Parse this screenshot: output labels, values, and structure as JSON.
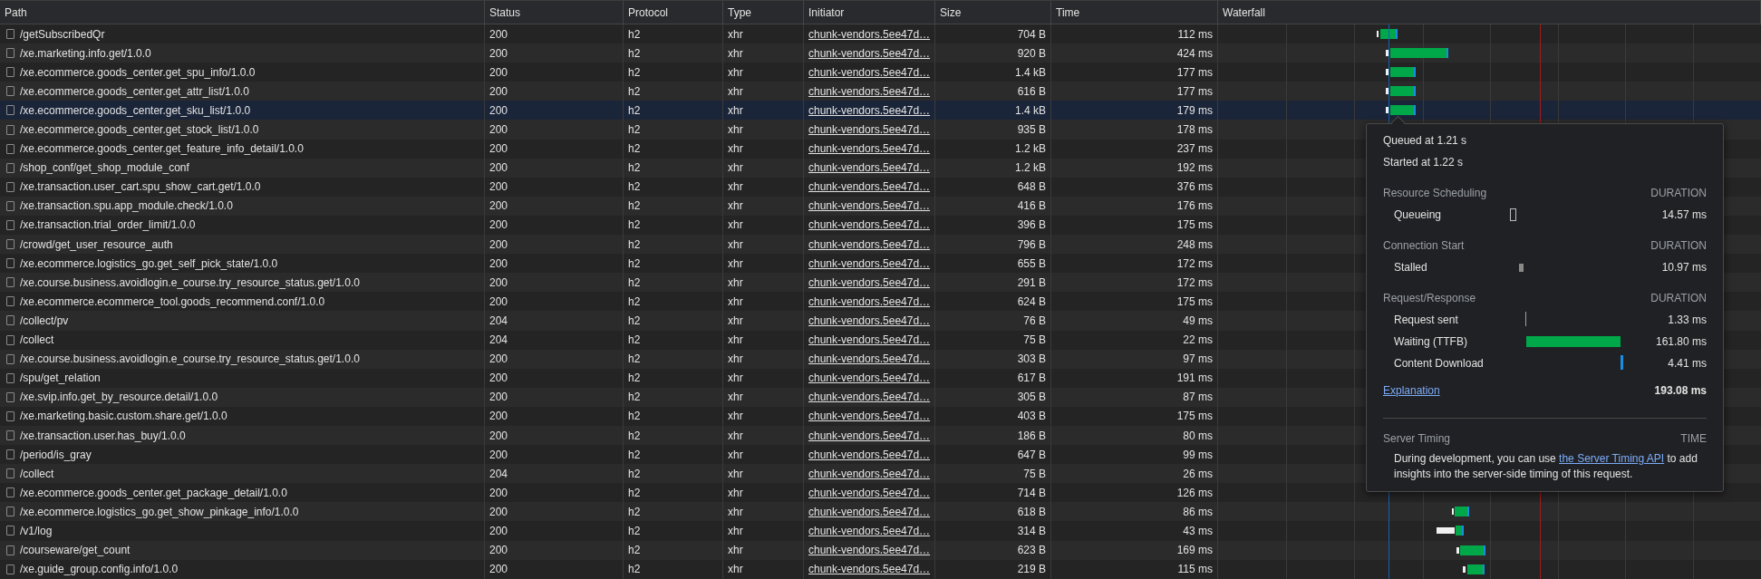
{
  "table": {
    "columns": [
      "Path",
      "Status",
      "Protocol",
      "Type",
      "Initiator",
      "Size",
      "Time",
      "Waterfall"
    ],
    "rows": [
      {
        "path": "/getSubscribedQr",
        "status": "200",
        "protocol": "h2",
        "type": "xhr",
        "initiator": "chunk-vendors.5ee47d…",
        "size": "704 B",
        "time": "112 ms",
        "checked": false,
        "selected": false
      },
      {
        "path": "/xe.marketing.info.get/1.0.0",
        "status": "200",
        "protocol": "h2",
        "type": "xhr",
        "initiator": "chunk-vendors.5ee47d…",
        "size": "920 B",
        "time": "424 ms",
        "checked": false,
        "selected": false
      },
      {
        "path": "/xe.ecommerce.goods_center.get_spu_info/1.0.0",
        "status": "200",
        "protocol": "h2",
        "type": "xhr",
        "initiator": "chunk-vendors.5ee47d…",
        "size": "1.4 kB",
        "time": "177 ms",
        "checked": false,
        "selected": false
      },
      {
        "path": "/xe.ecommerce.goods_center.get_attr_list/1.0.0",
        "status": "200",
        "protocol": "h2",
        "type": "xhr",
        "initiator": "chunk-vendors.5ee47d…",
        "size": "616 B",
        "time": "177 ms",
        "checked": false,
        "selected": false
      },
      {
        "path": "/xe.ecommerce.goods_center.get_sku_list/1.0.0",
        "status": "200",
        "protocol": "h2",
        "type": "xhr",
        "initiator": "chunk-vendors.5ee47d…",
        "size": "1.4 kB",
        "time": "179 ms",
        "checked": false,
        "selected": true
      },
      {
        "path": "/xe.ecommerce.goods_center.get_stock_list/1.0.0",
        "status": "200",
        "protocol": "h2",
        "type": "xhr",
        "initiator": "chunk-vendors.5ee47d…",
        "size": "935 B",
        "time": "178 ms",
        "checked": false,
        "selected": false
      },
      {
        "path": "/xe.ecommerce.goods_center.get_feature_info_detail/1.0.0",
        "status": "200",
        "protocol": "h2",
        "type": "xhr",
        "initiator": "chunk-vendors.5ee47d…",
        "size": "1.2 kB",
        "time": "237 ms",
        "checked": false,
        "selected": false
      },
      {
        "path": "/shop_conf/get_shop_module_conf",
        "status": "200",
        "protocol": "h2",
        "type": "xhr",
        "initiator": "chunk-vendors.5ee47d…",
        "size": "1.2 kB",
        "time": "192 ms",
        "checked": false,
        "selected": false
      },
      {
        "path": "/xe.transaction.user_cart.spu_show_cart.get/1.0.0",
        "status": "200",
        "protocol": "h2",
        "type": "xhr",
        "initiator": "chunk-vendors.5ee47d…",
        "size": "648 B",
        "time": "376 ms",
        "checked": false,
        "selected": false
      },
      {
        "path": "/xe.transaction.spu.app_module.check/1.0.0",
        "status": "200",
        "protocol": "h2",
        "type": "xhr",
        "initiator": "chunk-vendors.5ee47d…",
        "size": "416 B",
        "time": "176 ms",
        "checked": false,
        "selected": false
      },
      {
        "path": "/xe.transaction.trial_order_limit/1.0.0",
        "status": "200",
        "protocol": "h2",
        "type": "xhr",
        "initiator": "chunk-vendors.5ee47d…",
        "size": "396 B",
        "time": "175 ms",
        "checked": false,
        "selected": false
      },
      {
        "path": "/crowd/get_user_resource_auth",
        "status": "200",
        "protocol": "h2",
        "type": "xhr",
        "initiator": "chunk-vendors.5ee47d…",
        "size": "796 B",
        "time": "248 ms",
        "checked": false,
        "selected": false
      },
      {
        "path": "/xe.ecommerce.logistics_go.get_self_pick_state/1.0.0",
        "status": "200",
        "protocol": "h2",
        "type": "xhr",
        "initiator": "chunk-vendors.5ee47d…",
        "size": "655 B",
        "time": "172 ms",
        "checked": false,
        "selected": false
      },
      {
        "path": "/xe.course.business.avoidlogin.e_course.try_resource_status.get/1.0.0",
        "status": "200",
        "protocol": "h2",
        "type": "xhr",
        "initiator": "chunk-vendors.5ee47d…",
        "size": "291 B",
        "time": "172 ms",
        "checked": false,
        "selected": false
      },
      {
        "path": "/xe.ecommerce.ecommerce_tool.goods_recommend.conf/1.0.0",
        "status": "200",
        "protocol": "h2",
        "type": "xhr",
        "initiator": "chunk-vendors.5ee47d…",
        "size": "624 B",
        "time": "175 ms",
        "checked": false,
        "selected": false
      },
      {
        "path": "/collect/pv",
        "status": "204",
        "protocol": "h2",
        "type": "xhr",
        "initiator": "chunk-vendors.5ee47d…",
        "size": "76 B",
        "time": "49 ms",
        "checked": false,
        "selected": false
      },
      {
        "path": "/collect",
        "status": "204",
        "protocol": "h2",
        "type": "xhr",
        "initiator": "chunk-vendors.5ee47d…",
        "size": "75 B",
        "time": "22 ms",
        "checked": false,
        "selected": false
      },
      {
        "path": "/xe.course.business.avoidlogin.e_course.try_resource_status.get/1.0.0",
        "status": "200",
        "protocol": "h2",
        "type": "xhr",
        "initiator": "chunk-vendors.5ee47d…",
        "size": "303 B",
        "time": "97 ms",
        "checked": false,
        "selected": false
      },
      {
        "path": "/spu/get_relation",
        "status": "200",
        "protocol": "h2",
        "type": "xhr",
        "initiator": "chunk-vendors.5ee47d…",
        "size": "617 B",
        "time": "191 ms",
        "checked": false,
        "selected": false
      },
      {
        "path": "/xe.svip.info.get_by_resource.detail/1.0.0",
        "status": "200",
        "protocol": "h2",
        "type": "xhr",
        "initiator": "chunk-vendors.5ee47d…",
        "size": "305 B",
        "time": "87 ms",
        "checked": false,
        "selected": false
      },
      {
        "path": "/xe.marketing.basic.custom.share.get/1.0.0",
        "status": "200",
        "protocol": "h2",
        "type": "xhr",
        "initiator": "chunk-vendors.5ee47d…",
        "size": "403 B",
        "time": "175 ms",
        "checked": false,
        "selected": false
      },
      {
        "path": "/xe.transaction.user.has_buy/1.0.0",
        "status": "200",
        "protocol": "h2",
        "type": "xhr",
        "initiator": "chunk-vendors.5ee47d…",
        "size": "186 B",
        "time": "80 ms",
        "checked": false,
        "selected": false
      },
      {
        "path": "/period/is_gray",
        "status": "200",
        "protocol": "h2",
        "type": "xhr",
        "initiator": "chunk-vendors.5ee47d…",
        "size": "647 B",
        "time": "99 ms",
        "checked": false,
        "selected": false
      },
      {
        "path": "/collect",
        "status": "204",
        "protocol": "h2",
        "type": "xhr",
        "initiator": "chunk-vendors.5ee47d…",
        "size": "75 B",
        "time": "26 ms",
        "checked": false,
        "selected": false
      },
      {
        "path": "/xe.ecommerce.goods_center.get_package_detail/1.0.0",
        "status": "200",
        "protocol": "h2",
        "type": "xhr",
        "initiator": "chunk-vendors.5ee47d…",
        "size": "714 B",
        "time": "126 ms",
        "checked": false,
        "selected": false
      },
      {
        "path": "/xe.ecommerce.logistics_go.get_show_pinkage_info/1.0.0",
        "status": "200",
        "protocol": "h2",
        "type": "xhr",
        "initiator": "chunk-vendors.5ee47d…",
        "size": "618 B",
        "time": "86 ms",
        "checked": false,
        "selected": false
      },
      {
        "path": "/v1/log",
        "status": "200",
        "protocol": "h2",
        "type": "xhr",
        "initiator": "chunk-vendors.5ee47d…",
        "size": "314 B",
        "time": "43 ms",
        "checked": false,
        "selected": false
      },
      {
        "path": "/courseware/get_count",
        "status": "200",
        "protocol": "h2",
        "type": "xhr",
        "initiator": "chunk-vendors.5ee47d…",
        "size": "623 B",
        "time": "169 ms",
        "checked": false,
        "selected": false
      },
      {
        "path": "/xe.guide_group.config.info/1.0.0",
        "status": "200",
        "protocol": "h2",
        "type": "xhr",
        "initiator": "chunk-vendors.5ee47d…",
        "size": "219 B",
        "time": "115 ms",
        "checked": false,
        "selected": false
      }
    ]
  },
  "timing_popup": {
    "queued": "Queued at 1.21 s",
    "started": "Started at 1.22 s",
    "sections": [
      {
        "title": "Resource Scheduling",
        "column": "DURATION",
        "phases": [
          {
            "name": "Queueing",
            "kind": "queue",
            "duration": "14.57 ms"
          }
        ]
      },
      {
        "title": "Connection Start",
        "column": "DURATION",
        "phases": [
          {
            "name": "Stalled",
            "kind": "stall",
            "duration": "10.97 ms"
          }
        ]
      },
      {
        "title": "Request/Response",
        "column": "DURATION",
        "phases": [
          {
            "name": "Request sent",
            "kind": "send",
            "duration": "1.33 ms"
          },
          {
            "name": "Waiting (TTFB)",
            "kind": "wait",
            "duration": "161.80 ms"
          },
          {
            "name": "Content Download",
            "kind": "download",
            "duration": "4.41 ms"
          }
        ]
      }
    ],
    "explanation_link": "Explanation",
    "total": "193.08 ms",
    "server_timing": {
      "title": "Server Timing",
      "column": "TIME",
      "text_before": "During development, you can use ",
      "link": "the Server Timing API",
      "text_after": " to add insights into the server-side timing of this request."
    }
  }
}
